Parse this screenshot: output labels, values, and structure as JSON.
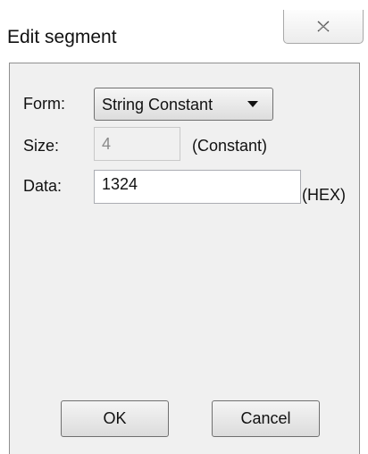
{
  "window": {
    "title": "Edit segment",
    "close_icon": "close-x-icon"
  },
  "form": {
    "form_label": "Form:",
    "form_value": "String Constant",
    "size_label": "Size:",
    "size_value": "4",
    "size_note": "(Constant)",
    "data_label": "Data:",
    "data_value": "1324",
    "data_note": "(HEX)"
  },
  "buttons": {
    "ok": "OK",
    "cancel": "Cancel"
  }
}
